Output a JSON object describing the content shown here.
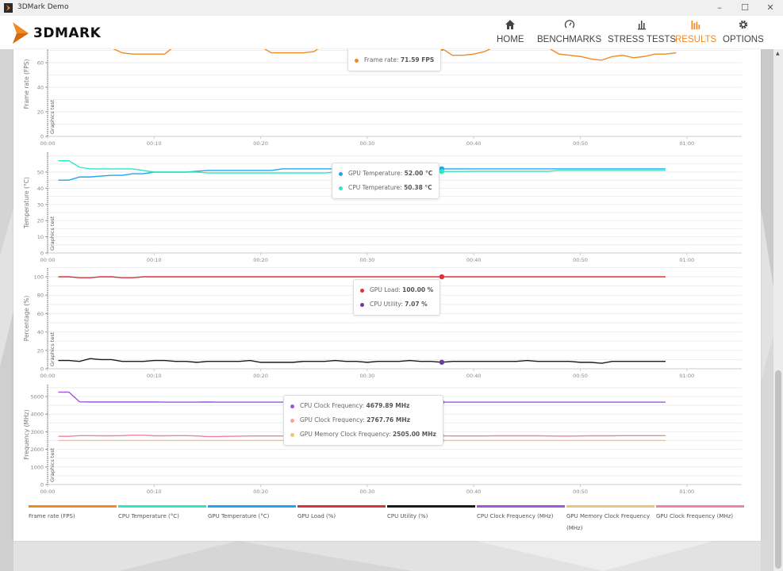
{
  "window": {
    "title": "3DMark Demo",
    "minimize": "–",
    "maximize": "☐",
    "close": "✕"
  },
  "header": {
    "logo": "3DMARK",
    "nav": [
      {
        "label": "HOME",
        "icon": "home-icon",
        "active": false
      },
      {
        "label": "BENCHMARKS",
        "icon": "gauge-icon",
        "active": false
      },
      {
        "label": "STRESS TESTS",
        "icon": "bar-chart-icon",
        "active": false
      },
      {
        "label": "RESULTS",
        "icon": "results-icon",
        "active": true
      },
      {
        "label": "OPTIONS",
        "icon": "gear-icon",
        "active": false
      }
    ],
    "accent": "#f08a24"
  },
  "marker_label": "Graphics test",
  "chart_data": [
    {
      "type": "line",
      "ylabel": "Frame rate (FPS)",
      "ylim": [
        0,
        80
      ],
      "yticks": [
        0,
        20,
        40,
        60
      ],
      "xticks": [
        "00:00",
        "00:10",
        "00:20",
        "00:30",
        "00:40",
        "00:50",
        "01:00"
      ],
      "xlim_seconds": [
        0,
        65
      ],
      "series": [
        {
          "name": "Frame rate",
          "color": "#f08a24",
          "x_start": 1,
          "values": [
            76,
            77,
            76,
            75,
            74,
            72,
            68,
            67,
            67,
            67,
            67,
            74,
            76,
            77,
            76,
            75,
            76,
            77,
            76,
            73,
            68,
            68,
            68,
            68,
            69,
            75,
            76,
            77,
            76,
            75,
            76,
            77,
            76,
            75,
            76,
            73,
            71.59,
            66,
            66,
            67,
            69,
            73,
            76,
            77,
            76,
            75,
            72,
            67,
            66,
            65,
            63,
            62,
            65,
            66,
            64,
            65,
            67,
            67,
            68
          ]
        }
      ],
      "tooltip": {
        "time": 37,
        "rows": [
          {
            "label": "Frame rate: ",
            "value": "71.59 FPS",
            "color": "#f08a24"
          }
        ]
      }
    },
    {
      "type": "line",
      "ylabel": "Temperature (°C)",
      "ylim": [
        0,
        60
      ],
      "yticks": [
        0,
        10,
        20,
        30,
        40,
        50
      ],
      "xticks": [
        "00:00",
        "00:10",
        "00:20",
        "00:30",
        "00:40",
        "00:50",
        "01:00"
      ],
      "xlim_seconds": [
        0,
        65
      ],
      "series": [
        {
          "name": "GPU Temperature",
          "color": "#1ea7f0",
          "x_start": 1,
          "values": [
            45,
            45,
            47,
            47,
            47.5,
            48,
            48,
            49,
            49,
            50,
            50,
            50,
            50,
            50.5,
            51,
            51,
            51,
            51,
            51,
            51,
            51,
            52,
            52,
            52,
            52,
            52,
            52,
            52,
            52,
            52,
            52,
            52,
            52,
            52,
            52,
            52,
            52,
            52,
            52,
            52,
            52,
            52,
            52,
            52,
            52,
            52,
            52,
            52,
            52,
            52,
            52,
            52,
            52,
            52,
            52,
            52,
            52,
            52
          ]
        },
        {
          "name": "CPU Temperature",
          "color": "#2ee8c0",
          "x_start": 1,
          "values": [
            57,
            57,
            53,
            52,
            52,
            52,
            52,
            52,
            51,
            50,
            50,
            50,
            50,
            50,
            49.5,
            49.5,
            49.5,
            49.5,
            49.5,
            49.5,
            49.5,
            49.5,
            49.5,
            49.5,
            49.5,
            49.5,
            50,
            50,
            50,
            50,
            50,
            50,
            50,
            50.4,
            50.4,
            50.4,
            50.38,
            50.4,
            50.4,
            50.5,
            50.5,
            50.5,
            50.5,
            50.5,
            50.5,
            50.5,
            50.5,
            51,
            51,
            51,
            51,
            51,
            51,
            51,
            51,
            51,
            51,
            51
          ]
        }
      ],
      "tooltip": {
        "time": 37,
        "rows": [
          {
            "label": "GPU Temperature: ",
            "value": "52.00 °C",
            "color": "#1ea7f0"
          },
          {
            "label": "CPU Temperature: ",
            "value": "50.38 °C",
            "color": "#2ee8c0"
          }
        ]
      }
    },
    {
      "type": "line",
      "ylabel": "Percentage (%)",
      "ylim": [
        0,
        110
      ],
      "yticks": [
        0,
        20,
        40,
        60,
        80,
        100
      ],
      "xticks": [
        "00:00",
        "00:10",
        "00:20",
        "00:30",
        "00:40",
        "00:50",
        "01:00"
      ],
      "xlim_seconds": [
        0,
        65
      ],
      "series": [
        {
          "name": "GPU Load",
          "color": "#d8343a",
          "x_start": 1,
          "values": [
            100,
            100,
            99,
            99,
            100,
            100,
            99,
            99,
            100,
            100,
            100,
            100,
            100,
            100,
            100,
            100,
            100,
            100,
            100,
            100,
            100,
            100,
            100,
            100,
            100,
            100,
            100,
            100,
            100,
            100,
            100,
            100,
            100,
            100,
            100,
            100,
            100,
            100,
            100,
            100,
            100,
            100,
            100,
            100,
            100,
            100,
            100,
            100,
            100,
            100,
            100,
            100,
            100,
            100,
            100,
            100,
            100,
            100
          ]
        },
        {
          "name": "CPU Utility",
          "color": "#1a1a1a",
          "x_start": 1,
          "values": [
            9,
            9,
            8,
            11,
            10,
            10,
            8,
            8,
            8,
            9,
            9,
            8,
            8,
            7,
            8,
            8,
            8,
            8,
            9,
            7,
            7,
            7,
            7,
            8,
            8,
            8,
            9,
            8,
            8,
            7,
            8,
            8,
            8,
            9,
            8,
            8,
            7.07,
            8,
            8,
            8,
            8,
            8,
            8,
            8,
            9,
            8,
            8,
            8,
            8,
            7,
            7,
            6,
            8,
            8,
            8,
            8,
            8,
            8
          ]
        }
      ],
      "tooltip": {
        "time": 37,
        "rows": [
          {
            "label": "GPU Load: ",
            "value": "100.00 %",
            "color": "#d8343a"
          },
          {
            "label": "CPU Utility: ",
            "value": "7.07 %",
            "color": "#6a3d9a"
          }
        ]
      }
    },
    {
      "type": "line",
      "ylabel": "Frequency (MHz)",
      "ylim": [
        0,
        5600
      ],
      "yticks": [
        0,
        1000,
        2000,
        3000,
        4000,
        5000
      ],
      "xticks": [
        "00:00",
        "00:10",
        "00:20",
        "00:30",
        "00:40",
        "00:50",
        "01:00"
      ],
      "xlim_seconds": [
        0,
        65
      ],
      "series": [
        {
          "name": "CPU Clock Frequency",
          "color": "#9b59d6",
          "x_start": 1,
          "values": [
            5250,
            5250,
            4700,
            4690,
            4690,
            4690,
            4690,
            4690,
            4690,
            4690,
            4680,
            4680,
            4680,
            4680,
            4690,
            4680,
            4680,
            4680,
            4680,
            4680,
            4680,
            4680,
            4680,
            4680,
            4680,
            4680,
            4680,
            4680,
            4680,
            4680,
            4680,
            4680,
            4680,
            4680,
            4680,
            4680,
            4679.89,
            4680,
            4680,
            4680,
            4680,
            4680,
            4680,
            4680,
            4680,
            4680,
            4680,
            4680,
            4680,
            4680,
            4680,
            4680,
            4680,
            4680,
            4680,
            4680,
            4680,
            4680
          ]
        },
        {
          "name": "GPU Clock Frequency",
          "color": "#ee82a8",
          "x_start": 1,
          "values": [
            2740,
            2740,
            2780,
            2780,
            2770,
            2770,
            2780,
            2800,
            2800,
            2770,
            2770,
            2780,
            2780,
            2760,
            2730,
            2730,
            2740,
            2750,
            2760,
            2760,
            2760,
            2760,
            2770,
            2770,
            2770,
            2770,
            2770,
            2770,
            2770,
            2770,
            2770,
            2770,
            2770,
            2770,
            2770,
            2770,
            2767.76,
            2760,
            2760,
            2760,
            2760,
            2770,
            2770,
            2770,
            2770,
            2770,
            2760,
            2750,
            2750,
            2760,
            2770,
            2770,
            2770,
            2780,
            2780,
            2780,
            2780,
            2780
          ]
        },
        {
          "name": "GPU Memory Clock Frequency",
          "color": "#e8c878",
          "x_start": 1,
          "values": [
            2505,
            2505,
            2505,
            2505,
            2505,
            2505,
            2505,
            2505,
            2505,
            2505,
            2505,
            2505,
            2505,
            2505,
            2505,
            2505,
            2505,
            2505,
            2505,
            2505,
            2505,
            2505,
            2505,
            2505,
            2505,
            2505,
            2505,
            2505,
            2505,
            2505,
            2505,
            2505,
            2505,
            2505,
            2505,
            2505,
            2505,
            2505,
            2505,
            2505,
            2505,
            2505,
            2505,
            2505,
            2505,
            2505,
            2505,
            2505,
            2505,
            2505,
            2505,
            2505,
            2505,
            2505,
            2505,
            2505,
            2505,
            2505
          ]
        }
      ],
      "tooltip": {
        "time": 37,
        "rows": [
          {
            "label": "CPU Clock Frequency: ",
            "value": "4679.89 MHz",
            "color": "#9b59d6"
          },
          {
            "label": "GPU Clock Frequency: ",
            "value": "2767.76 MHz",
            "color": "#f0a890"
          },
          {
            "label": "GPU Memory Clock Frequency: ",
            "value": "2505.00 MHz",
            "color": "#e8c878"
          }
        ]
      }
    }
  ],
  "legend": [
    {
      "label": "Frame rate (FPS)",
      "color": "#f08a24"
    },
    {
      "label": "CPU Temperature (°C)",
      "color": "#2ee8c0"
    },
    {
      "label": "GPU Temperature (°C)",
      "color": "#1ea7f0"
    },
    {
      "label": "GPU Load (%)",
      "color": "#d8343a"
    },
    {
      "label": "CPU Utility (%)",
      "color": "#1a1a1a"
    },
    {
      "label": "CPU Clock Frequency (MHz)",
      "color": "#9b59d6"
    },
    {
      "label": "GPU Memory Clock Frequency (MHz)",
      "color": "#e8c878"
    },
    {
      "label": "GPU Clock Frequency (MHz)",
      "color": "#ee82a8"
    }
  ]
}
